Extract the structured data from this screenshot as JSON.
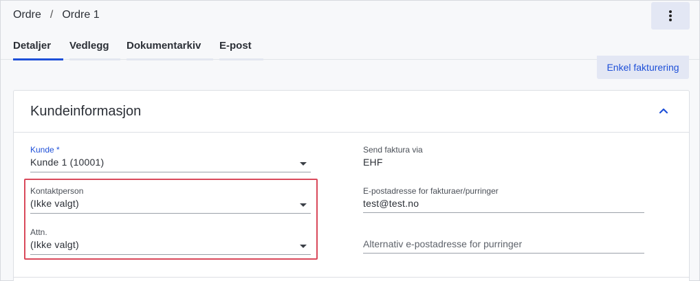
{
  "breadcrumb": {
    "root": "Ordre",
    "separator": "/",
    "current": "Ordre 1"
  },
  "menu": {
    "icon": "kebab-menu-icon"
  },
  "tabs": [
    {
      "label": "Detaljer",
      "active": true
    },
    {
      "label": "Vedlegg"
    },
    {
      "label": "Dokumentarkiv"
    },
    {
      "label": "E-post"
    }
  ],
  "actions": {
    "enkel_fakturering": "Enkel fakturering"
  },
  "section": {
    "title": "Kundeinformasjon",
    "toggle_icon": "chevron-up-icon"
  },
  "fields": {
    "kunde": {
      "label": "Kunde *",
      "value": "Kunde 1 (10001)"
    },
    "kontaktperson": {
      "label": "Kontaktperson",
      "value": "(Ikke valgt)"
    },
    "attn": {
      "label": "Attn.",
      "value": "(Ikke valgt)"
    },
    "send_faktura": {
      "label": "Send faktura via",
      "value": "EHF"
    },
    "epost": {
      "label": "E-postadresse for fakturaer/purringer",
      "value": "test@test.no"
    },
    "alt_epost": {
      "placeholder": "Alternativ e-postadresse for purringer"
    }
  },
  "colors": {
    "accent": "#1d4fd8",
    "highlight": "#d9485a",
    "button_bg": "#e3e7f4"
  }
}
